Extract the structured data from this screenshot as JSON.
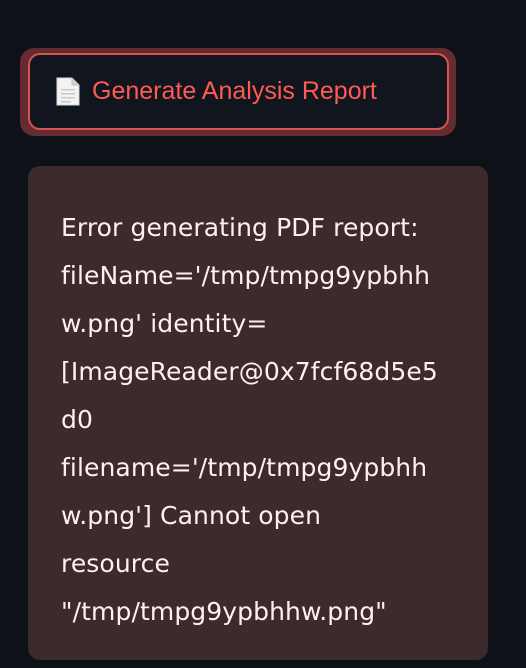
{
  "button": {
    "icon": "document-icon",
    "label": "Generate Analysis Report"
  },
  "error": {
    "lines": [
      "Error generating PDF report:",
      "fileName='/tmp/tmpg9ypbhh",
      "w.png' identity=",
      "[ImageReader@0x7fcf68d5e5",
      "d0",
      "filename='/tmp/tmpg9ypbhh",
      "w.png'] Cannot open",
      "resource",
      "\"/tmp/tmpg9ypbhhw.png\""
    ]
  },
  "colors": {
    "page_background": "#0e1117",
    "button_text": "#ff5a55",
    "button_border": "#d9534f",
    "error_background": "#3d2a2c",
    "error_text": "#fff0f0"
  }
}
